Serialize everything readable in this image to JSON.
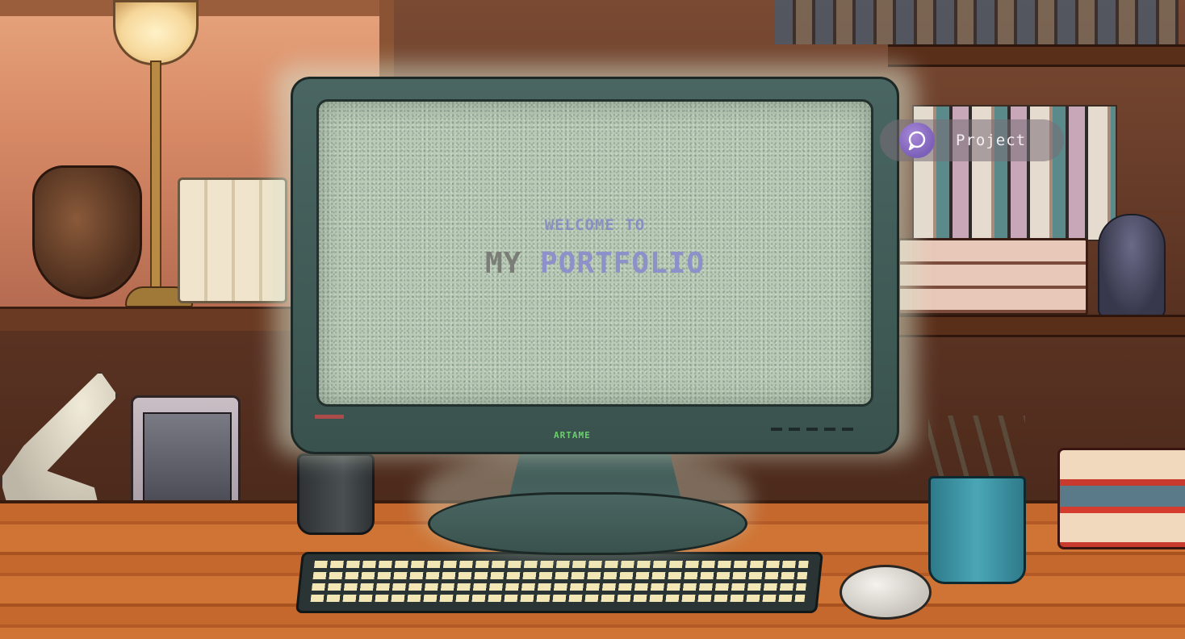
{
  "screen": {
    "welcome": "WELCOME TO",
    "title_part1": "MY",
    "title_part2": "PORTFOLIO",
    "brand": "ARTAME"
  },
  "nav": {
    "project_label": "Project",
    "project_icon": "chat-bubble-icon"
  },
  "colors": {
    "screen_bg": "#b9cab6",
    "accent_text": "#8d90c9",
    "muted_text": "#7a7e76",
    "chip_icon": "#7b5fb8"
  }
}
